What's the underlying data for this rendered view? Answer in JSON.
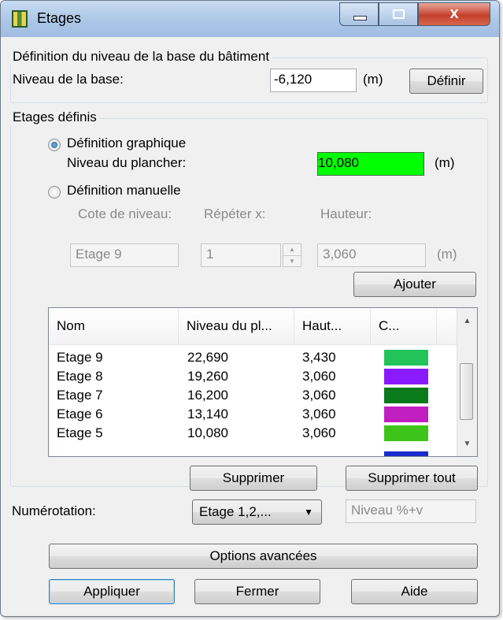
{
  "window": {
    "title": "Etages",
    "close_glyph": "x"
  },
  "base": {
    "group_label": "Définition du niveau de la base du bâtiment",
    "label": "Niveau de la base:",
    "value": "-6,120",
    "unit": "(m)",
    "define_button": "Définir"
  },
  "floors": {
    "group_label": "Etages définis",
    "graphic_radio": "Définition graphique",
    "floor_level_label": "Niveau du plancher:",
    "floor_level_value": "10,080",
    "floor_level_unit": "(m)",
    "manual_radio": "Définition manuelle",
    "col_level": "Cote de niveau:",
    "col_repeat": "Répéter x:",
    "col_height": "Hauteur:",
    "name_value": "Etage 9",
    "repeat_value": "1",
    "height_value": "3,060",
    "height_unit": "(m)",
    "add_button": "Ajouter",
    "highlight_color": "#00ff00"
  },
  "table": {
    "headers": [
      "Nom",
      "Niveau du pl...",
      "Haut...",
      "C..."
    ],
    "rows": [
      {
        "name": "Etage 9",
        "level": "22,690",
        "height": "3,430",
        "color": "#22c45a"
      },
      {
        "name": "Etage 8",
        "level": "19,260",
        "height": "3,060",
        "color": "#8a1aff"
      },
      {
        "name": "Etage 7",
        "level": "16,200",
        "height": "3,060",
        "color": "#0a7a1a"
      },
      {
        "name": "Etage 6",
        "level": "13,140",
        "height": "3,060",
        "color": "#c21fc2"
      },
      {
        "name": "Etage 5",
        "level": "10,080",
        "height": "3,060",
        "color": "#3cc41a"
      }
    ],
    "partial_row_color": "#1a2ccc"
  },
  "actions": {
    "delete_button": "Supprimer",
    "delete_all_button": "Supprimer tout",
    "numbering_label": "Numérotation:",
    "numbering_value": "Etage 1,2,...",
    "numbering_pattern": "Niveau %+v",
    "advanced_button": "Options avancées",
    "apply_button": "Appliquer",
    "close_button": "Fermer",
    "help_button": "Aide"
  }
}
